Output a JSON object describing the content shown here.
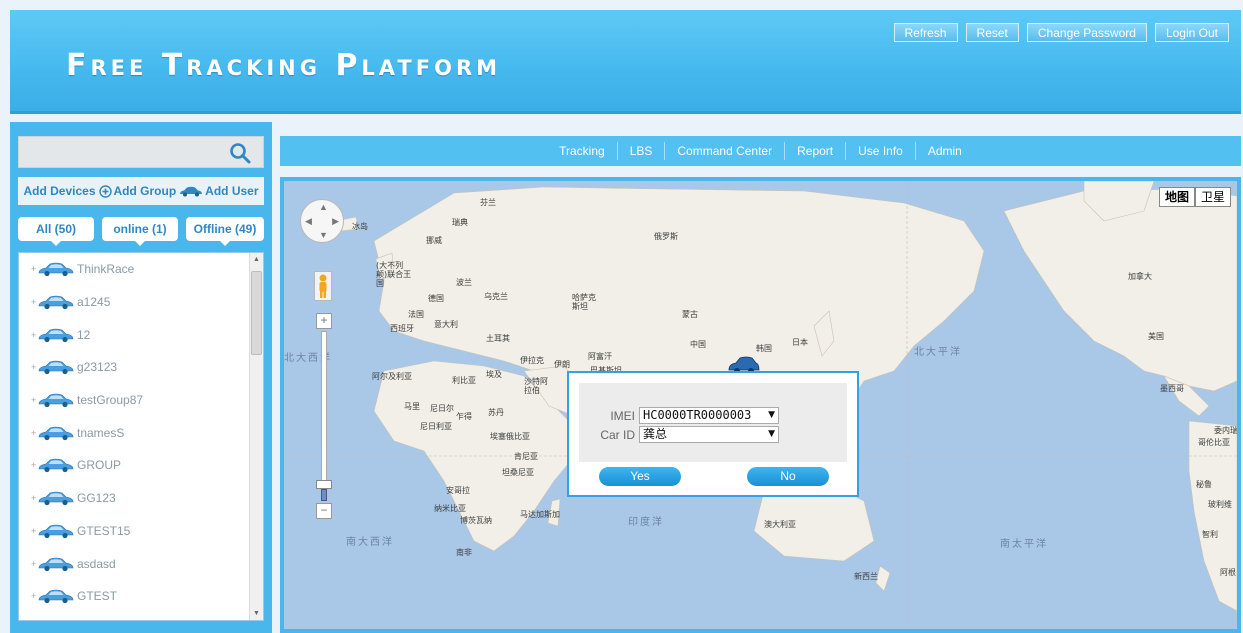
{
  "header": {
    "brand": "Free Tracking Platform",
    "buttons": [
      "Refresh",
      "Reset",
      "Change Password",
      "Login Out"
    ]
  },
  "sidebar": {
    "search": {
      "value": "",
      "placeholder": "",
      "icon": "search-icon"
    },
    "actions": {
      "add_devices": "Add Devices",
      "add_group": "Add Group",
      "add_user": "Add User"
    },
    "filters": [
      {
        "label": "All (50)"
      },
      {
        "label": "online (1)"
      },
      {
        "label": "Offline (49)"
      }
    ],
    "devices": [
      "ThinkRace",
      "a1245",
      "12",
      "g23123",
      "testGroup87",
      "tnamesS",
      "GROUP",
      "GG123",
      "GTEST15",
      "asdasd",
      "GTEST"
    ]
  },
  "nav": {
    "items": [
      "Tracking",
      "LBS",
      "Command Center",
      "Report",
      "Use Info",
      "Admin"
    ]
  },
  "map": {
    "type_buttons": [
      "地图",
      "卫星"
    ],
    "active_type": "地图",
    "labels": [
      "芬兰",
      "瑞典",
      "挪威",
      "冰岛",
      "俄罗斯",
      "(大不列颠)联合王国",
      "波兰",
      "德国",
      "乌克兰",
      "法国",
      "意大利",
      "西班牙",
      "哈萨克斯坦",
      "蒙古",
      "土耳其",
      "中国",
      "日本",
      "韩国",
      "伊拉克",
      "伊朗",
      "阿富汗",
      "巴基斯坦",
      "阿尔及利亚",
      "利比亚",
      "埃及",
      "沙特阿拉伯",
      "马里",
      "尼日尔",
      "乍得",
      "苏丹",
      "尼日利亚",
      "埃塞俄比亚",
      "肯尼亚",
      "坦桑尼亚",
      "安哥拉",
      "纳米比亚",
      "博茨瓦纳",
      "马达加斯加",
      "南非",
      "澳大利亚",
      "新西兰",
      "加拿大",
      "美国",
      "墨西哥",
      "委内瑞",
      "哥伦比亚",
      "秘鲁",
      "玻利维",
      "智利",
      "阿根"
    ],
    "oceans": [
      "北大平洋",
      "北大西洋",
      "南大西洋",
      "印度洋",
      "南太平洋"
    ],
    "zoom_level": 0.1
  },
  "dialog": {
    "imei_label": "IMEI",
    "imei_value": "HC0000TR0000003",
    "carid_label": "Car ID",
    "carid_value": "龚总",
    "yes": "Yes",
    "no": "No"
  }
}
